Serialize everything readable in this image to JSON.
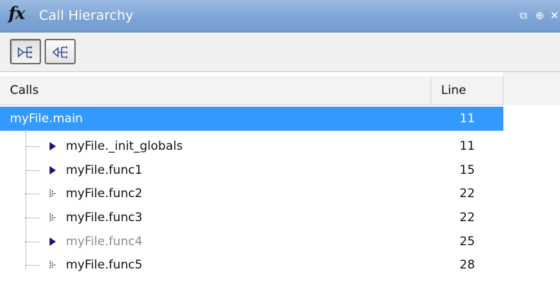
{
  "window": {
    "icon": "fx-icon",
    "icon_text": "fx",
    "title": "Call Hierarchy",
    "controls": {
      "undock": "⧉",
      "pin": "⊕",
      "close": "✕"
    }
  },
  "toolbar": {
    "buttons": [
      {
        "name": "show-callees",
        "icon": "callees-icon",
        "pressed": true
      },
      {
        "name": "show-callers",
        "icon": "callers-icon",
        "pressed": false
      }
    ]
  },
  "table": {
    "columns": {
      "calls": "Calls",
      "line": "Line"
    },
    "root": {
      "name": "myFile.main",
      "line": "11",
      "selected": true
    },
    "children": [
      {
        "name": "myFile._init_globals",
        "line": "11",
        "expander": "filled-arrow",
        "dim": false
      },
      {
        "name": "myFile.func1",
        "line": "15",
        "expander": "filled-arrow",
        "dim": false
      },
      {
        "name": "myFile.func2",
        "line": "22",
        "expander": "dotted-arrow",
        "dim": false
      },
      {
        "name": "myFile.func3",
        "line": "22",
        "expander": "dotted-arrow",
        "dim": false
      },
      {
        "name": "myFile.func4",
        "line": "25",
        "expander": "filled-arrow",
        "dim": true
      },
      {
        "name": "myFile.func5",
        "line": "28",
        "expander": "dotted-arrow",
        "dim": false
      }
    ]
  },
  "colors": {
    "title_bar": "#7ea5d6",
    "selection": "#3399ff",
    "expander_arrow": "#1a1a70",
    "dim_text": "#8c8c8c"
  }
}
